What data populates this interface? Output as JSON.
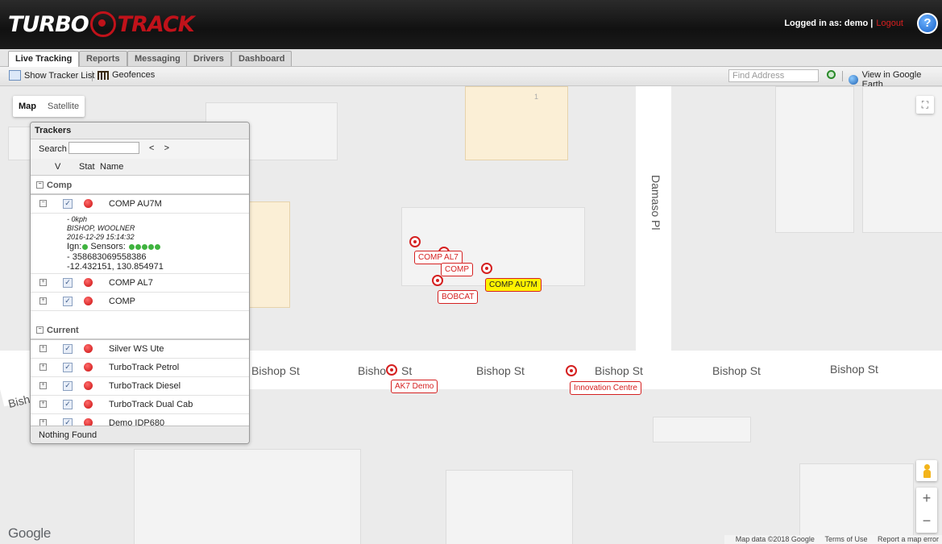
{
  "header": {
    "logo_left": "TURBO",
    "logo_right": "TRACK",
    "login_text": "Logged in as: demo |",
    "logout_label": "Logout",
    "help_label": "?"
  },
  "tabs": [
    "Live Tracking",
    "Reports",
    "Messaging",
    "Drivers",
    "Dashboard"
  ],
  "toolbar": {
    "show_tracker_list": "Show Tracker List",
    "geofences": "Geofences",
    "find_placeholder": "Find Address",
    "google_earth": "View in Google Earth"
  },
  "map": {
    "map_type_map": "Map",
    "map_type_satellite": "Satellite",
    "street_damaso": "Damaso Pl",
    "bishop_labels": [
      "Bishop St",
      "Bishop St",
      "Bishop St",
      "Bishop St",
      "Bishop St",
      "Bishop St"
    ],
    "bishop_partial_left": "Bish",
    "bishop_partial_mid": "Bisho",
    "bishop_partial_st": "St",
    "lot_number": "1",
    "markers": {
      "comp_al7": "COMP AL7",
      "comp": "COMP",
      "comp_au7m": "COMP AU7M",
      "bobcat": "BOBCAT",
      "ak7_demo": "AK7 Demo",
      "innovation_centre": "Innovation Centre"
    },
    "zoom_in": "+",
    "zoom_out": "−",
    "google_logo": "Google",
    "attribution": {
      "map_data": "Map data ©2018 Google",
      "terms": "Terms of Use",
      "report": "Report a map error"
    }
  },
  "trackers_panel": {
    "title": "Trackers",
    "search_label": "Search",
    "search_value": "",
    "prev": "<",
    "next": ">",
    "col_v": "V",
    "col_stat": "Stat",
    "col_name": "Name",
    "groups": {
      "comp": "Comp",
      "current": "Current"
    },
    "comp_au7m": {
      "name": "COMP AU7M",
      "speed": "- 0kph",
      "location": "BISHOP, WOOLNER",
      "time": "2016-12-29 15:14:32",
      "ign_label": "Ign:",
      "sensors_label": "Sensors:",
      "id": "- 358683069558386",
      "coords": "-12.432151, 130.854971"
    },
    "comp_rows": [
      "COMP AL7",
      "COMP"
    ],
    "current_rows": [
      "Silver WS Ute",
      "TurboTrack Petrol",
      "TurboTrack Diesel",
      "TurboTrack Dual Cab",
      "Demo IDP680"
    ],
    "footer": "Nothing Found"
  }
}
